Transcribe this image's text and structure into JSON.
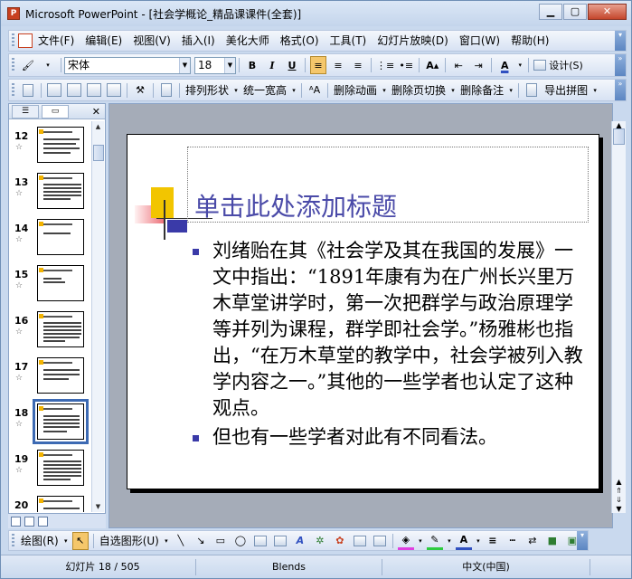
{
  "window": {
    "title": "Microsoft PowerPoint - [社会学概论_精品课课件(全套)]",
    "app_icon_letter": "P"
  },
  "menu": {
    "items": [
      "文件(F)",
      "编辑(E)",
      "视图(V)",
      "插入(I)",
      "美化大师",
      "格式(O)",
      "工具(T)",
      "幻灯片放映(D)",
      "窗口(W)",
      "帮助(H)"
    ]
  },
  "format_bar": {
    "font": "宋体",
    "size": "18",
    "bold": "B",
    "italic": "I",
    "underline": "U",
    "design_label": "设计(S)"
  },
  "ext_bar": {
    "arrange": "排列形状",
    "same_width": "统一宽高",
    "delete_anim": "删除动画",
    "delete_transition": "删除页切换",
    "delete_notes": "删除备注",
    "export": "导出拼图"
  },
  "thumbnails": [
    {
      "num": "12"
    },
    {
      "num": "13"
    },
    {
      "num": "14"
    },
    {
      "num": "15"
    },
    {
      "num": "16"
    },
    {
      "num": "17"
    },
    {
      "num": "18"
    },
    {
      "num": "19"
    },
    {
      "num": "20"
    }
  ],
  "slide": {
    "title": "单击此处添加标题",
    "bullets": [
      "刘绪贻在其《社会学及其在我国的发展》一文中指出：“1891年康有为在广州长兴里万木草堂讲学时，第一次把群学与政治原理学等并列为课程，群学即社会学。”杨雅彬也指出，“在万木草堂的教学中，社会学被列入教学内容之一。”其他的一些学者也认定了这种观点。",
      "但也有一些学者对此有不同看法。"
    ]
  },
  "draw_bar": {
    "draw": "绘图(R)",
    "autoshapes": "自选图形(U)"
  },
  "status": {
    "slide": "幻灯片 18 / 505",
    "template": "Blends",
    "language": "中文(中国)"
  },
  "colors": {
    "title_blue": "#4a4aa8",
    "bullet_blue": "#3a3aa8",
    "selected_outline": "#3d6ab3"
  }
}
